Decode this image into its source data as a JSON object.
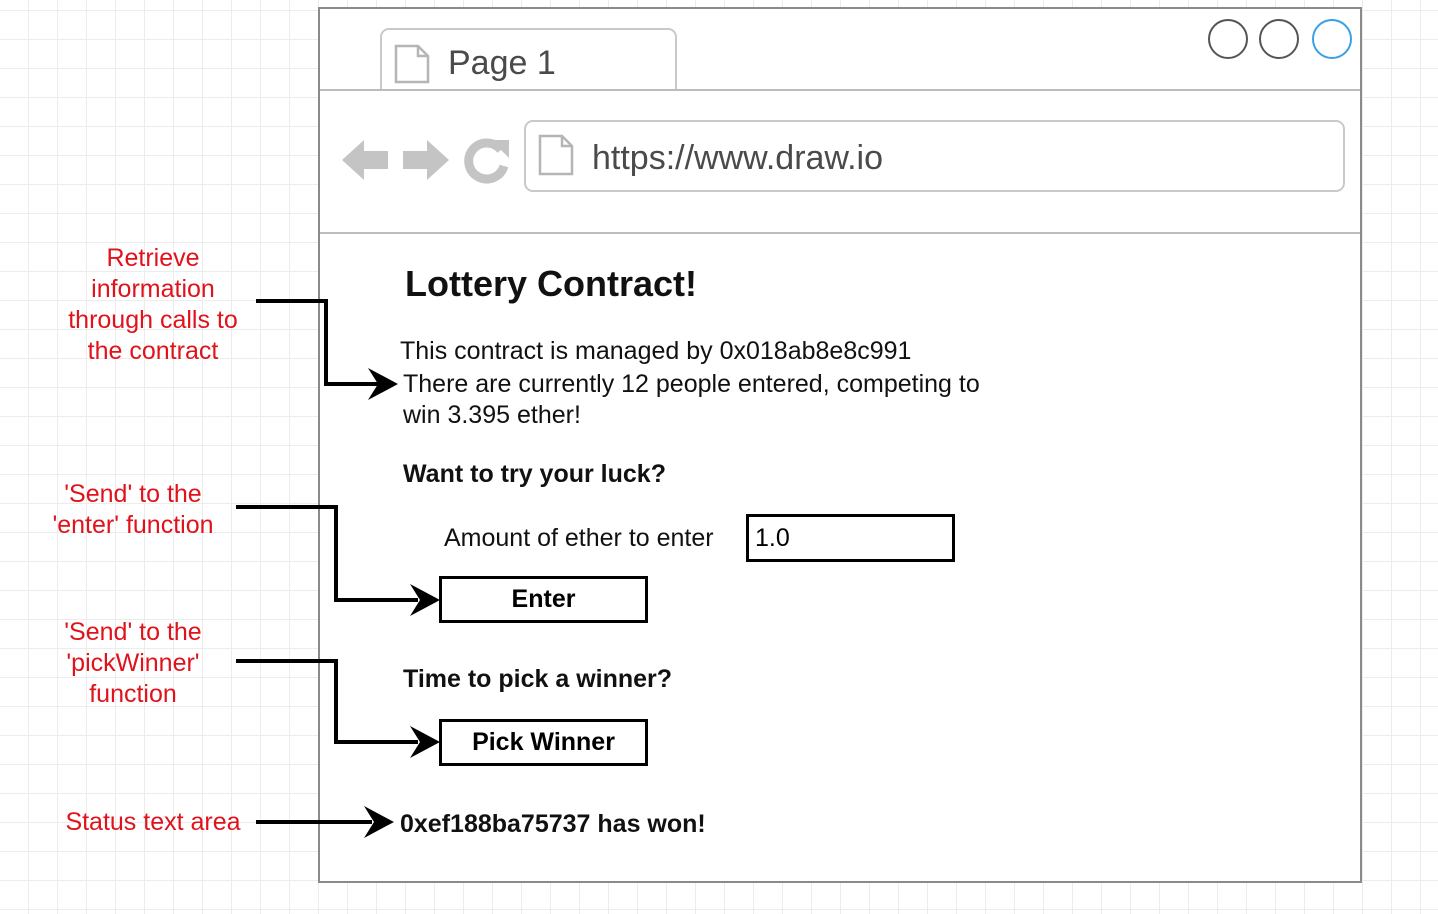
{
  "browser": {
    "tab_label": "Page 1",
    "url": "https://www.draw.io",
    "accent_color": "#3a9ee8"
  },
  "page": {
    "title": "Lottery Contract!",
    "manager_line": "This contract is managed by 0x018ab8e8c991",
    "entered_line_1": "There are currently 12 people entered, competing to",
    "entered_line_2": "win 3.395 ether!",
    "try_luck_heading": "Want to try your luck?",
    "amount_label": "Amount of ether to enter",
    "amount_value": "1.0",
    "enter_button": "Enter",
    "pick_heading": "Time to pick a winner?",
    "pick_button": "Pick Winner",
    "status_text": "0xef188ba75737 has won!"
  },
  "annotations": {
    "retrieve": [
      "Retrieve",
      "information",
      "through calls to",
      "the contract"
    ],
    "send_enter": [
      "'Send' to the",
      "'enter' function"
    ],
    "send_pick": [
      "'Send' to the",
      "'pickWinner'",
      "function"
    ],
    "status": [
      "Status text area"
    ],
    "color": "#e0121b"
  }
}
